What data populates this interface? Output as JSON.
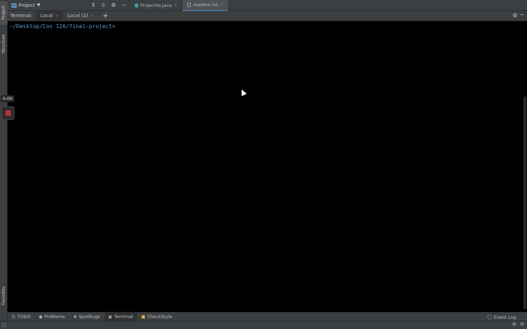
{
  "left_strip": {
    "project_label": "Project",
    "structure_label": "Structure",
    "favorites_label": "Favorites"
  },
  "top_bar": {
    "project_selector": "Project",
    "tabs": [
      {
        "label": "Projectile.java",
        "icon": "java-class-icon",
        "active": false
      },
      {
        "label": "readme.txt",
        "icon": "text-file-icon",
        "active": true
      }
    ]
  },
  "terminal": {
    "header_label": "Terminal:",
    "tabs": [
      {
        "label": "Local",
        "active": true
      },
      {
        "label": "Local (2)",
        "active": false
      }
    ],
    "add_tab_glyph": "+",
    "prompt": "~/Desktop/Cos 126/final-project>"
  },
  "recording": {
    "time": "0:00"
  },
  "bottom_bar": {
    "tabs": [
      {
        "label": "TODO",
        "icon": "todo-icon"
      },
      {
        "label": "Problems",
        "icon": "problems-icon"
      },
      {
        "label": "SpotBugs",
        "icon": "bug-icon"
      },
      {
        "label": "Terminal",
        "icon": "terminal-icon"
      },
      {
        "label": "CheckStyle",
        "icon": "checkstyle-icon"
      }
    ],
    "event_log": "Event Log"
  },
  "colors": {
    "accent": "#4a88c7",
    "prompt": "#5c9bd6",
    "record": "#b2343d"
  }
}
